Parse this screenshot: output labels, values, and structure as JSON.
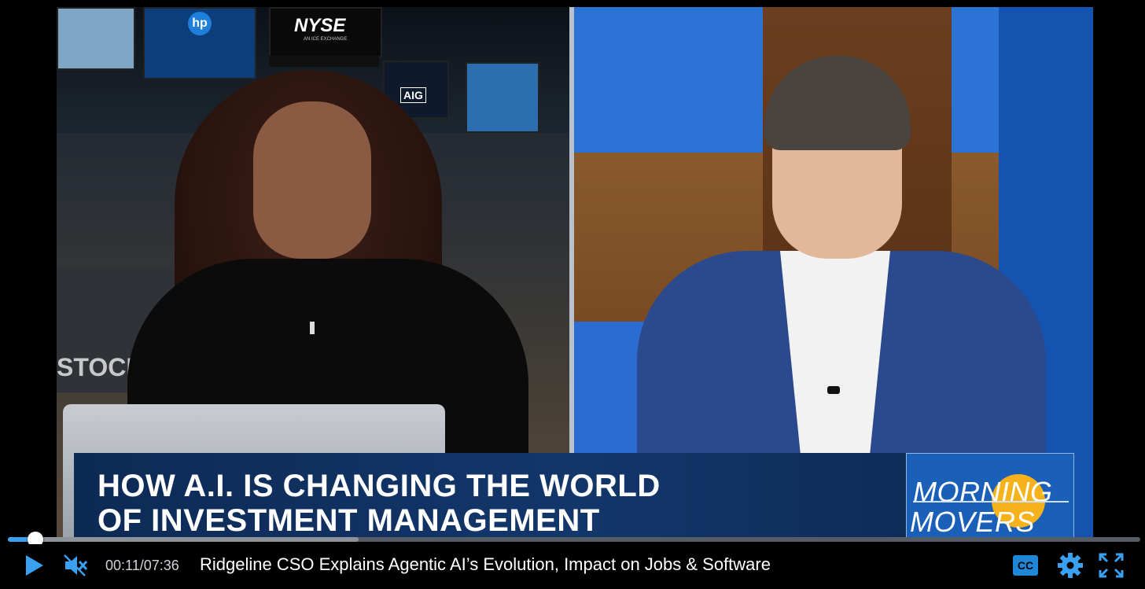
{
  "video": {
    "studio_signs": {
      "nyse": "NYSE",
      "nyse_sub": "AN ICE EXCHANGE",
      "hp": "hp",
      "aig": "AIG",
      "stock": "STOCK"
    },
    "lower_third": {
      "headline_line1": "HOW A.I. IS CHANGING THE WORLD",
      "headline_line2": "OF INVESTMENT MANAGEMENT",
      "show_logo_line1": "MORNING",
      "show_logo_line2": "MOVERS"
    }
  },
  "player": {
    "elapsed": "00:11",
    "duration": "07:36",
    "time_display": "00:11/07:36",
    "progress": 0.024,
    "buffered": 0.31,
    "title": "Ridgeline CSO Explains Agentic AI’s Evolution, Impact on Jobs & Software",
    "icons": {
      "play": "play-icon",
      "mute": "volume-muted-icon",
      "captions": "closed-captions-icon",
      "settings": "gear-icon",
      "fullscreen": "fullscreen-icon"
    },
    "accent_color": "#3aa0f0"
  }
}
